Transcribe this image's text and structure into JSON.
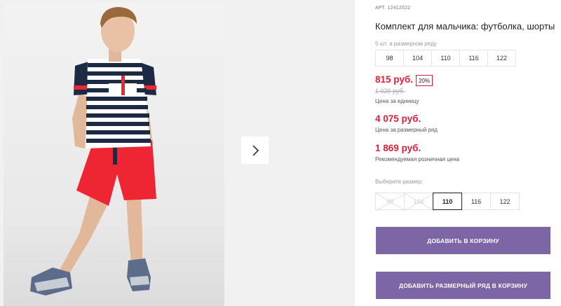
{
  "product": {
    "article_label": "АРТ.",
    "article_number": "12412022",
    "title": "Комплект для мальчика: футболка, шорты",
    "size_row_caption": "5 шт. в размерном ряду",
    "size_row_sizes": [
      "98",
      "104",
      "110",
      "116",
      "122"
    ],
    "price": "815 руб.",
    "discount": "20%",
    "old_price": "1 020 руб.",
    "price_caption": "Цена за единицу",
    "row_price": "4 075 руб.",
    "row_price_caption": "Цена за размерный ряд",
    "retail_price": "1 869 руб.",
    "retail_price_caption": "Рекомендуемая розничная цена",
    "choose_size_label": "Выберите размер:",
    "size_options": [
      {
        "label": "98",
        "state": "unavailable"
      },
      {
        "label": "104",
        "state": "unavailable"
      },
      {
        "label": "110",
        "state": "selected"
      },
      {
        "label": "116",
        "state": "available"
      },
      {
        "label": "122",
        "state": "available"
      }
    ]
  },
  "buttons": {
    "add_to_cart": "ДОБАВИТЬ В КОРЗИНУ",
    "add_size_row": "ДОБАВИТЬ РАЗМЕРНЫЙ РЯД В КОРЗИНУ"
  },
  "gallery": {
    "next_icon": "chevron-right-icon"
  },
  "colors": {
    "accent_button": "#7d66a6",
    "price_red": "#e01e37"
  }
}
